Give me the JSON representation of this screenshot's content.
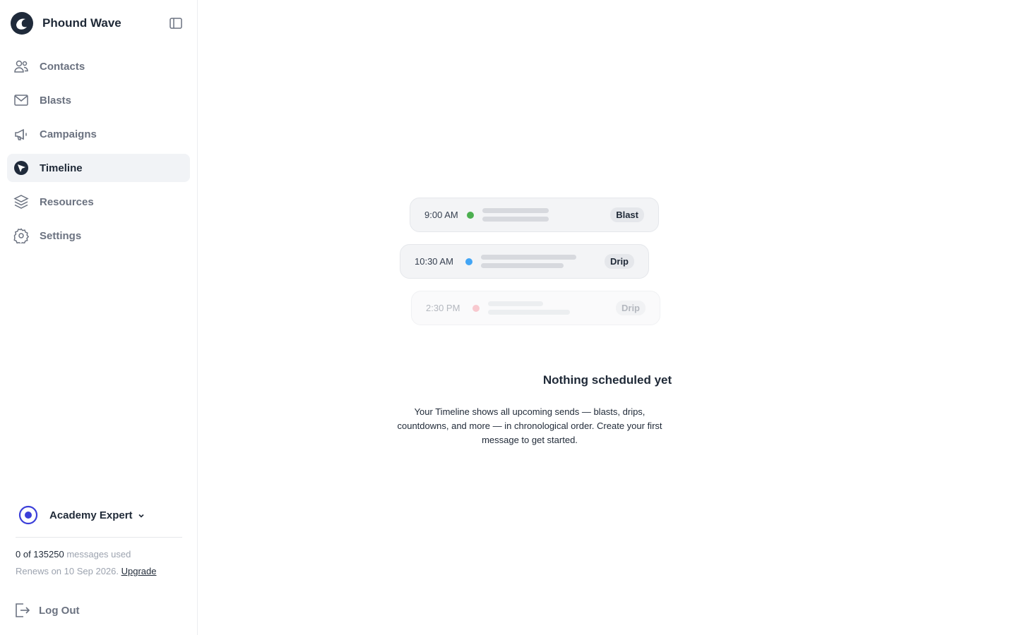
{
  "brand": {
    "name": "Phound Wave"
  },
  "nav": {
    "items": [
      {
        "label": "Contacts",
        "icon": "users-icon"
      },
      {
        "label": "Blasts",
        "icon": "mail-icon"
      },
      {
        "label": "Campaigns",
        "icon": "megaphone-icon"
      },
      {
        "label": "Timeline",
        "icon": "timeline-icon",
        "active": true
      },
      {
        "label": "Resources",
        "icon": "layers-icon"
      },
      {
        "label": "Settings",
        "icon": "gear-icon"
      }
    ]
  },
  "account": {
    "name": "Academy Expert"
  },
  "usage": {
    "count": "0 of 135250",
    "suffix": "messages used",
    "renews": "Renews on 10 Sep 2026.",
    "upgrade": "Upgrade"
  },
  "logout": {
    "label": "Log Out"
  },
  "timeline_preview": [
    {
      "time": "9:00 AM",
      "badge": "Blast",
      "dot_color": "#4caf50"
    },
    {
      "time": "10:30 AM",
      "badge": "Drip",
      "dot_color": "#42a5f5"
    },
    {
      "time": "2:30 PM",
      "badge": "Drip",
      "dot_color": "#f8c9cf"
    }
  ],
  "empty_state": {
    "title": "Nothing scheduled yet",
    "description": "Your Timeline shows all upcoming sends — blasts, drips, countdowns, and more — in chronological order. Create your first message to get started."
  },
  "colors": {
    "accent": "#3b3fd9",
    "brand_dark": "#1f2a3a"
  }
}
